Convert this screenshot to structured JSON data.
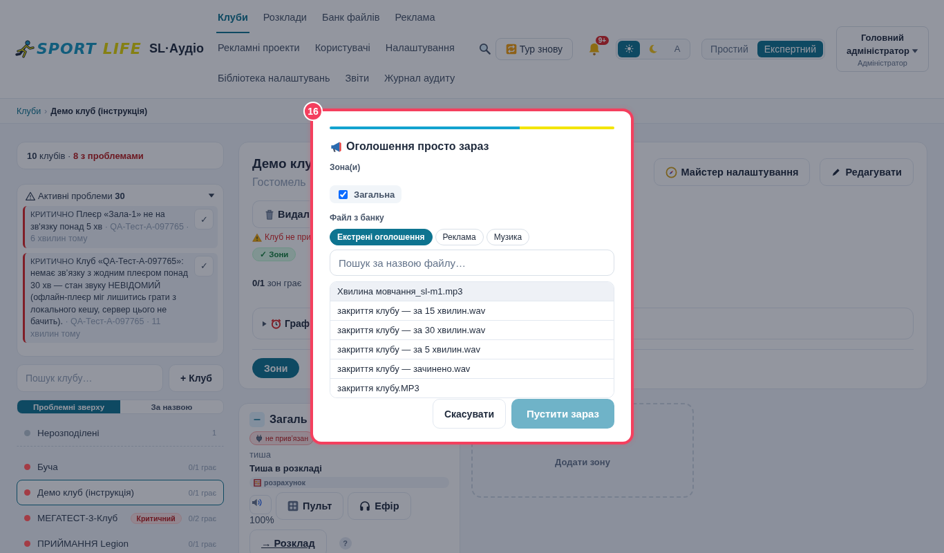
{
  "header": {
    "logo": {
      "word_1": "SPORT",
      "word_2": "LIFE"
    },
    "app_name": "SL·Аудіо",
    "nav_rows": [
      {
        "items": [
          {
            "label": "Клуби",
            "selected": true
          },
          {
            "label": "Розклади",
            "selected": false
          },
          {
            "label": "Банк файлів",
            "selected": false
          },
          {
            "label": "Реклама",
            "selected": false
          }
        ]
      },
      {
        "items": [
          {
            "label": "Рекламні проекти",
            "selected": false
          },
          {
            "label": "Користувачі",
            "selected": false
          },
          {
            "label": "Налаштування",
            "selected": false
          }
        ],
        "search": true
      },
      {
        "items": [
          {
            "label": "Бібліотека налаштувань",
            "selected": false
          },
          {
            "label": "Звіти",
            "selected": false
          },
          {
            "label": "Журнал аудиту",
            "selected": false
          }
        ]
      }
    ],
    "tour_button": "Тур знову",
    "notifications_badge": "9+",
    "theme_options": [
      {
        "kind": "sun",
        "selected": true
      },
      {
        "kind": "moon",
        "selected": false
      },
      {
        "kind": "auto",
        "label": "A",
        "selected": false
      }
    ],
    "mode_options": [
      {
        "label": "Простий",
        "selected": false
      },
      {
        "label": "Експертний",
        "selected": true
      }
    ],
    "user": {
      "name": "Головний адміністратор",
      "role": "Адміністратор"
    }
  },
  "breadcrumb": {
    "separator": "›",
    "items": [
      {
        "label": "Клуби",
        "current": false
      },
      {
        "label": "Демо клуб (інструкція)",
        "current": true
      }
    ]
  },
  "sidebar": {
    "summary": "**10** клубів · **8 з проблемами**",
    "problems": {
      "title": "Активні проблеми **30**",
      "expanded": true,
      "items": [
        {
          "severity": "КРИТИЧНО",
          "text": "Плеєр «Зала-1» не на зв'язку понад 5 хв",
          "meta": "· QA-Тест-А-097765 · 6 хвилин тому",
          "ack": "✓"
        },
        {
          "severity": "КРИТИЧНО",
          "text": "Клуб «QA-Тест-А-097765»: немає зв’язку з жодним плеєром понад 30 хв — стан звуку НЕВІДОМИЙ (офлайн-плеєр міг лишитись грати з локального кешу, сервер цього не бачить).",
          "meta": "· QA-Тест-А-097765 · 11 хвилин тому",
          "ack": "✓"
        }
      ]
    },
    "search_placeholder": "Пошук клубу…",
    "add_button": "+ Клуб",
    "sort_options": [
      {
        "label": "Проблемні зверху",
        "selected": true
      },
      {
        "label": "За назвою",
        "selected": false
      }
    ],
    "clubs": [
      {
        "kind": "group",
        "name": "Нерозподілені",
        "color": "#6b7685",
        "count": "1",
        "selected": false
      },
      {
        "kind": "club",
        "name": "Буча",
        "color": "#a33c45",
        "status": "0/1 грає",
        "selected": false
      },
      {
        "kind": "club",
        "name": "Демо клуб (інструкція)",
        "color": "#a33c45",
        "status": "0/1 грає",
        "selected": true
      },
      {
        "kind": "club",
        "name": "МЕГАТЕСТ-3-Клуб",
        "color": "#a33c45",
        "badge": "Критичний",
        "status": "0/2 грає",
        "selected": false
      },
      {
        "kind": "club",
        "name": "ПРИЙМАННЯ Legion",
        "color": "#a33c45",
        "status": "0/1 грає",
        "selected": false
      }
    ]
  },
  "club": {
    "title": "Демо клу",
    "subtitle": "Гостомель",
    "actions": [
      {
        "kind": "wizard",
        "label": "Майстер налаштування"
      },
      {
        "kind": "edit",
        "label": "Редагувати"
      }
    ],
    "delete_button": "Видал",
    "warning": "Клуб не при",
    "chips": [
      {
        "kind": "ok",
        "label": "✓ Зони"
      }
    ],
    "zones_playing": "**0/1** зон грає",
    "schedule": {
      "title": "Граф",
      "expanded": false
    },
    "tabs": [
      {
        "label": "Зони",
        "selected": true
      }
    ],
    "zones": [
      {
        "title": "Загаль",
        "badge": "не прив’язан",
        "state": "тиша",
        "schedule": "Тиша в розкладі",
        "calc": "розрахунок",
        "volume": "100%",
        "buttons": [
          {
            "kind": "console",
            "label": "Пульт"
          },
          {
            "kind": "air",
            "label": "Ефір"
          }
        ],
        "schedule_link": "→ Розклад",
        "help": "?"
      }
    ],
    "add_zone": "Додати зону"
  },
  "modal": {
    "step": "16",
    "title": "Оголошення просто зараз",
    "zones_label": "Зона(и)",
    "zones": [
      {
        "label": "Загальна",
        "checked": true
      }
    ],
    "file_label": "Файл з банку",
    "categories": [
      {
        "label": "Екстрені оголошення",
        "selected": true
      },
      {
        "label": "Реклама",
        "selected": false
      },
      {
        "label": "Музика",
        "selected": false
      }
    ],
    "search_placeholder": "Пошук за назвою файлу…",
    "files": [
      {
        "name": "Хвилина мовчання_sl-m1.mp3",
        "selected": true
      },
      {
        "name": "закриття клубу — за 15 хвилин.wav",
        "selected": false
      },
      {
        "name": "закриття клубу — за 30 хвилин.wav",
        "selected": false
      },
      {
        "name": "закриття клубу — за 5 хвилин.wav",
        "selected": false
      },
      {
        "name": "закриття клубу — зачинено.wav",
        "selected": false
      },
      {
        "name": "закриття клубу.MP3",
        "selected": false
      }
    ],
    "cancel": "Скасувати",
    "confirm": {
      "label": "Пустити зараз",
      "disabled": true
    }
  }
}
